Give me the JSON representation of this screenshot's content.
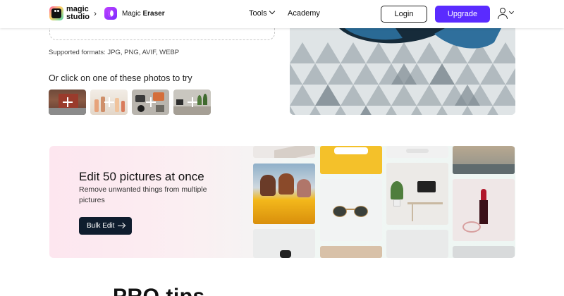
{
  "header": {
    "logo_text_line1": "magic",
    "logo_text_line2": "studio",
    "product_name_prefix": "Magic",
    "product_name_bold": "Eraser",
    "nav": {
      "tools_label": "Tools",
      "academy_label": "Academy"
    },
    "login_label": "Login",
    "upgrade_label": "Upgrade",
    "upgrade_color": "#5a2bff"
  },
  "upload": {
    "supported_formats": "Supported formats: JPG, PNG, AVIF, WEBP",
    "try_heading": "Or click on one of these photos to try",
    "samples": [
      "sample-garage",
      "sample-bottles",
      "sample-desk",
      "sample-plants"
    ]
  },
  "banner": {
    "title": "Edit 50 pictures at once",
    "subtitle": "Remove unwanted things from multiple pictures",
    "button_label": "Bulk Edit"
  },
  "bottom": {
    "heading_partial": "PRO tips                                  "
  }
}
